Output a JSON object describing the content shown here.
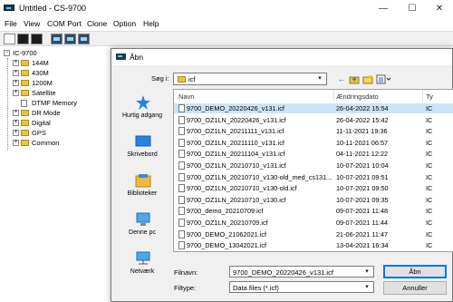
{
  "app": {
    "title": "Untitled - CS-9700",
    "window_controls": {
      "minimize": "—",
      "maximize": "☐",
      "close": "✕"
    }
  },
  "menubar": {
    "items": [
      {
        "label": "File"
      },
      {
        "label": "View"
      },
      {
        "label": "COM Port"
      },
      {
        "label": "Clone"
      },
      {
        "label": "Option"
      },
      {
        "label": "Help"
      }
    ]
  },
  "tree": {
    "root": "IC-9700",
    "items": [
      {
        "label": "144M",
        "expander": "+"
      },
      {
        "label": "430M",
        "expander": "+"
      },
      {
        "label": "1200M",
        "expander": "+"
      },
      {
        "label": "Satellite",
        "expander": "+"
      },
      {
        "label": "DTMF Memory",
        "expander": ""
      },
      {
        "label": "DR Mode",
        "expander": "+"
      },
      {
        "label": "Digital",
        "expander": "+"
      },
      {
        "label": "GPS",
        "expander": "+"
      },
      {
        "label": "Common",
        "expander": "+"
      }
    ]
  },
  "dialog": {
    "title": "Åbn",
    "look_in_label": "Søg i:",
    "look_in_value": "icf",
    "places": [
      {
        "label": "Hurtig adgang",
        "icon": "star-icon"
      },
      {
        "label": "Skrivebord",
        "icon": "desktop-icon"
      },
      {
        "label": "Biblioteker",
        "icon": "libraries-icon"
      },
      {
        "label": "Denne pc",
        "icon": "computer-icon"
      },
      {
        "label": "Netværk",
        "icon": "network-icon"
      }
    ],
    "columns": {
      "name": "Navn",
      "date": "Ændringsdato",
      "type": "Ty"
    },
    "files": [
      {
        "name": "9700_DEMO_20220426_v131.icf",
        "date": "26-04-2022 15:54",
        "type": "IC",
        "selected": true
      },
      {
        "name": "9700_OZ1LN_20220426_v131.icf",
        "date": "26-04-2022 15:42",
        "type": "IC",
        "selected": false
      },
      {
        "name": "9700_OZ1LN_20211111_v131.icf",
        "date": "11-11-2021 19:36",
        "type": "IC",
        "selected": false
      },
      {
        "name": "9700_OZ1LN_20211110_v131.icf",
        "date": "10-11-2021 06:57",
        "type": "IC",
        "selected": false
      },
      {
        "name": "9700_OZ1LN_20211104_v131.icf",
        "date": "04-11-2021 12:22",
        "type": "IC",
        "selected": false
      },
      {
        "name": "9700_OZ1LN_20210710_v131.icf",
        "date": "10-07-2021 10:04",
        "type": "IC",
        "selected": false
      },
      {
        "name": "9700_OZ1LN_20210710_v130-old_med_cs131...",
        "date": "10-07-2021 09:51",
        "type": "IC",
        "selected": false
      },
      {
        "name": "9700_OZ1LN_20210710_v130-old.icf",
        "date": "10-07-2021 09:50",
        "type": "IC",
        "selected": false
      },
      {
        "name": "9700_OZ1LN_20210710_v130.icf",
        "date": "10-07-2021 09:35",
        "type": "IC",
        "selected": false
      },
      {
        "name": "9700_demo_20210709.icf",
        "date": "09-07-2021 11:48",
        "type": "IC",
        "selected": false
      },
      {
        "name": "9700_OZ1LN_20210709.icf",
        "date": "09-07-2021 11:44",
        "type": "IC",
        "selected": false
      },
      {
        "name": "9700_DEMO_21062021.icf",
        "date": "21-06-2021 11:47",
        "type": "IC",
        "selected": false
      },
      {
        "name": "9700_DEMO_13042021.icf",
        "date": "13-04-2021 16:34",
        "type": "IC",
        "selected": false
      }
    ],
    "filename_label": "Filnavn:",
    "filename_value": "9700_DEMO_20220426_v131.icf",
    "filetype_label": "Filtype:",
    "filetype_value": "Data files (*.icf)",
    "open_label": "Åbn",
    "cancel_label": "Annuller"
  }
}
